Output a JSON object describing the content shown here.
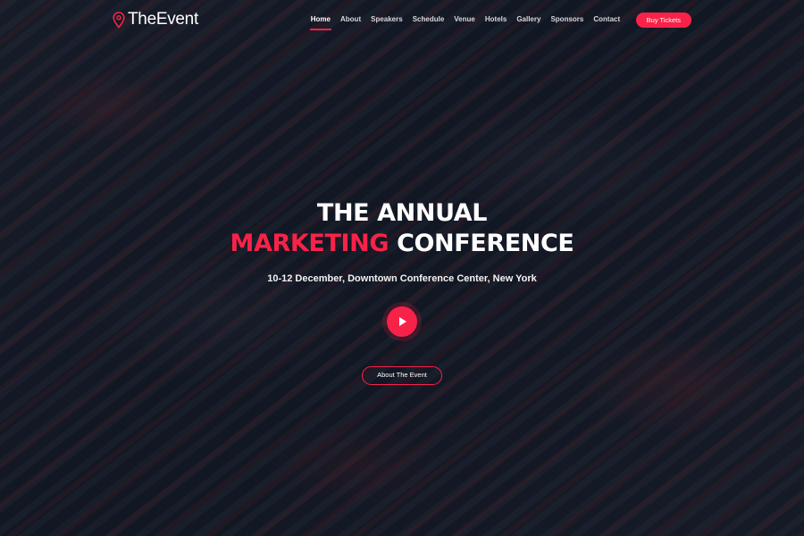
{
  "header": {
    "logo_prefix": "The",
    "logo_suffix": "Event",
    "nav": [
      {
        "label": "Home",
        "active": true
      },
      {
        "label": "About",
        "active": false
      },
      {
        "label": "Speakers",
        "active": false
      },
      {
        "label": "Schedule",
        "active": false
      },
      {
        "label": "Venue",
        "active": false
      },
      {
        "label": "Hotels",
        "active": false
      },
      {
        "label": "Gallery",
        "active": false
      },
      {
        "label": "Sponsors",
        "active": false
      },
      {
        "label": "Contact",
        "active": false
      }
    ],
    "cta_label": "Buy Tickets"
  },
  "hero": {
    "title_line1": "The Annual",
    "title_accent": "Marketing",
    "title_line2_rest": "Conference",
    "subtitle": "10-12 December, Downtown Conference Center, New York",
    "about_button_label": "About The Event"
  },
  "theme": {
    "accent": "#f82249",
    "background": "#101522"
  },
  "icons": {
    "logo": "map-pin-icon",
    "video": "play-icon"
  }
}
